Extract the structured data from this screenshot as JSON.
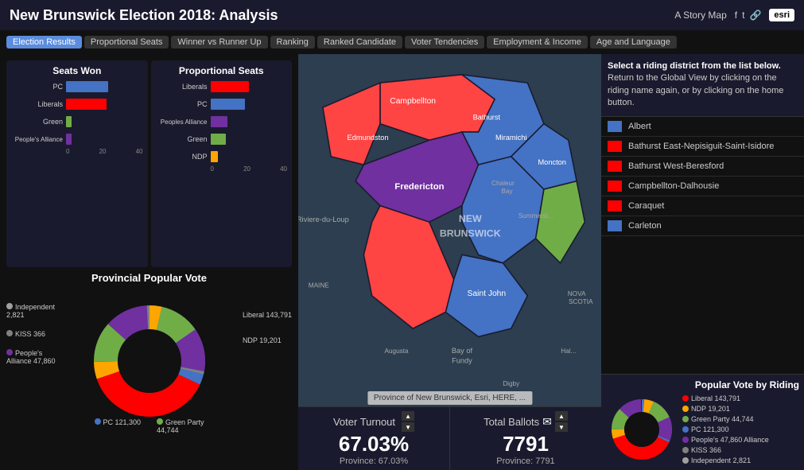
{
  "header": {
    "title": "New Brunswick Election 2018: Analysis",
    "story_map_label": "A Story Map",
    "esri_label": "esri"
  },
  "nav_tabs": [
    {
      "label": "Election Results",
      "active": true
    },
    {
      "label": "Proportional Seats",
      "active": false
    },
    {
      "label": "Winner vs Runner Up",
      "active": false
    },
    {
      "label": "Ranking",
      "active": false
    },
    {
      "label": "Ranked Candidate",
      "active": false
    },
    {
      "label": "Voter Tendencies",
      "active": false
    },
    {
      "label": "Employment & Income",
      "active": false
    },
    {
      "label": "Age and Language",
      "active": false
    }
  ],
  "seats_won": {
    "title": "Seats Won",
    "parties": [
      {
        "name": "PC",
        "value": 22,
        "color": "#4472C4"
      },
      {
        "name": "Liberals",
        "value": 21,
        "color": "#FF0000"
      },
      {
        "name": "Green",
        "value": 3,
        "color": "#70AD47"
      },
      {
        "name": "People's Alliance",
        "value": 3,
        "color": "#7030A0"
      }
    ],
    "max": 40,
    "axis": [
      "0",
      "20",
      "40"
    ]
  },
  "proportional_seats": {
    "title": "Proportional Seats",
    "parties": [
      {
        "name": "Liberals",
        "value": 20,
        "color": "#FF0000"
      },
      {
        "name": "PC",
        "value": 18,
        "color": "#4472C4"
      },
      {
        "name": "Peoples Alliance",
        "value": 9,
        "color": "#7030A0"
      },
      {
        "name": "Green",
        "value": 8,
        "color": "#70AD47"
      },
      {
        "name": "NDP",
        "value": 4,
        "color": "#FFA500"
      }
    ],
    "max": 40,
    "axis": [
      "0",
      "20",
      "40"
    ]
  },
  "provincial_popular_vote": {
    "title": "Provincial Popular Vote",
    "slices": [
      {
        "label": "Liberal 143,791",
        "color": "#FF0000",
        "value": 37.8,
        "position": "right-top"
      },
      {
        "label": "NDP 19,201",
        "color": "#FFA500",
        "value": 5.0,
        "position": "right-bottom"
      },
      {
        "label": "Green Party 44,744",
        "color": "#70AD47",
        "value": 11.8,
        "position": "bottom-right"
      },
      {
        "label": "PC 121,300",
        "color": "#4472C4",
        "value": 31.9,
        "position": "bottom-left"
      },
      {
        "label": "People's Alliance 47,860",
        "color": "#7030A0",
        "value": 12.6,
        "position": "left-bottom"
      },
      {
        "label": "KISS 366",
        "color": "#808080",
        "value": 0.1,
        "position": "left-top"
      },
      {
        "label": "Independent 2,821",
        "color": "#A0A0A0",
        "value": 0.7,
        "position": "left-top2"
      }
    ]
  },
  "voter_turnout": {
    "label": "Voter Turnout",
    "value": "67.03%",
    "sub": "Province: 67.03%"
  },
  "total_ballots": {
    "label": "Total Ballots",
    "value": "7791",
    "sub": "Province: 7791"
  },
  "riding_instructions": {
    "bold": "Select a riding district from the list below.",
    "normal": "Return to the Global View by clicking on the riding name again, or by clicking on the home button."
  },
  "riding_list": [
    {
      "name": "Albert",
      "color": "#4472C4"
    },
    {
      "name": "Bathurst East-Nepisiguit-Saint-Isidore",
      "color": "#FF0000"
    },
    {
      "name": "Bathurst West-Beresford",
      "color": "#FF0000"
    },
    {
      "name": "Campbellton-Dalhousie",
      "color": "#FF0000"
    },
    {
      "name": "Caraquet",
      "color": "#FF0000"
    },
    {
      "name": "Carleton",
      "color": "#4472C4"
    }
  ],
  "popular_vote_riding": {
    "title": "Popular Vote by Riding",
    "legend": [
      {
        "label": "Liberal 143,791",
        "color": "#FF0000"
      },
      {
        "label": "NDP 19,201",
        "color": "#FFA500"
      },
      {
        "label": "Green Party 44,744",
        "color": "#70AD47"
      },
      {
        "label": "PC 121,300",
        "color": "#4472C4"
      },
      {
        "label": "People's 47,860 Alliance",
        "color": "#7030A0"
      },
      {
        "label": "KISS 366",
        "color": "#808080"
      },
      {
        "label": "Independent 2,821",
        "color": "#A0A0A0"
      }
    ]
  },
  "map_info_banner": "Province of New Brunswick, Esri, HERE, ...",
  "colors": {
    "pc": "#4472C4",
    "liberal": "#FF0000",
    "green": "#70AD47",
    "peoples_alliance": "#7030A0",
    "ndp": "#FFA500",
    "kiss": "#808080",
    "independent": "#A0A0A0"
  }
}
